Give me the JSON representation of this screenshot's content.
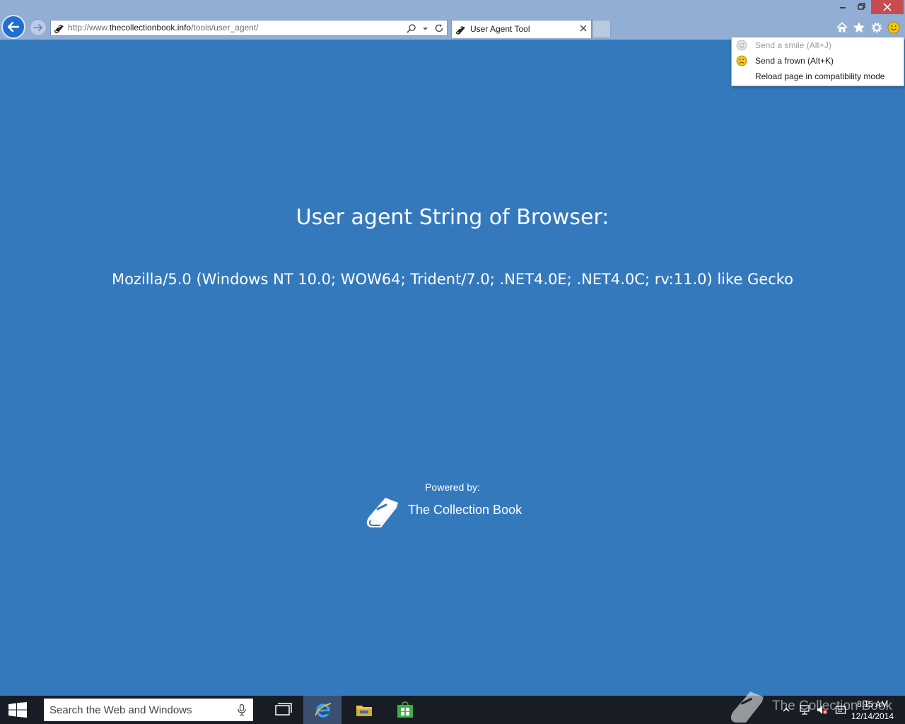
{
  "browser": {
    "address_url_prefix": "http://www.",
    "address_url_host": "thecollectionbook.info",
    "address_url_path": "/tools/user_agent/",
    "tab_title": "User Agent Tool"
  },
  "feedback_menu": {
    "items": [
      {
        "label": "Send a smile (Alt+J)",
        "disabled": true
      },
      {
        "label": "Send a frown (Alt+K)",
        "disabled": false
      },
      {
        "label": "Reload page in compatibility mode",
        "disabled": false
      }
    ]
  },
  "page": {
    "title": "User agent String of Browser:",
    "user_agent": "Mozilla/5.0 (Windows NT 10.0; WOW64; Trident/7.0; .NET4.0E; .NET4.0C; rv:11.0) like Gecko",
    "powered_by_label": "Powered by:",
    "powered_by_name": "The Collection Book"
  },
  "taskbar": {
    "search_placeholder": "Search the Web and Windows",
    "clock_time": "8:15 AM",
    "clock_date": "12/14/2014",
    "watermark_text": "The Collection Book"
  },
  "colors": {
    "page_background": "#3579bd",
    "chrome_background": "#93aed4",
    "taskbar_background": "#181c24",
    "close_button": "#c74b50"
  },
  "icons": {
    "back": "back-arrow-icon",
    "forward": "forward-arrow-icon",
    "home": "home-icon",
    "favorites": "star-icon",
    "tools": "gear-icon",
    "feedback": "smiley-icon"
  }
}
